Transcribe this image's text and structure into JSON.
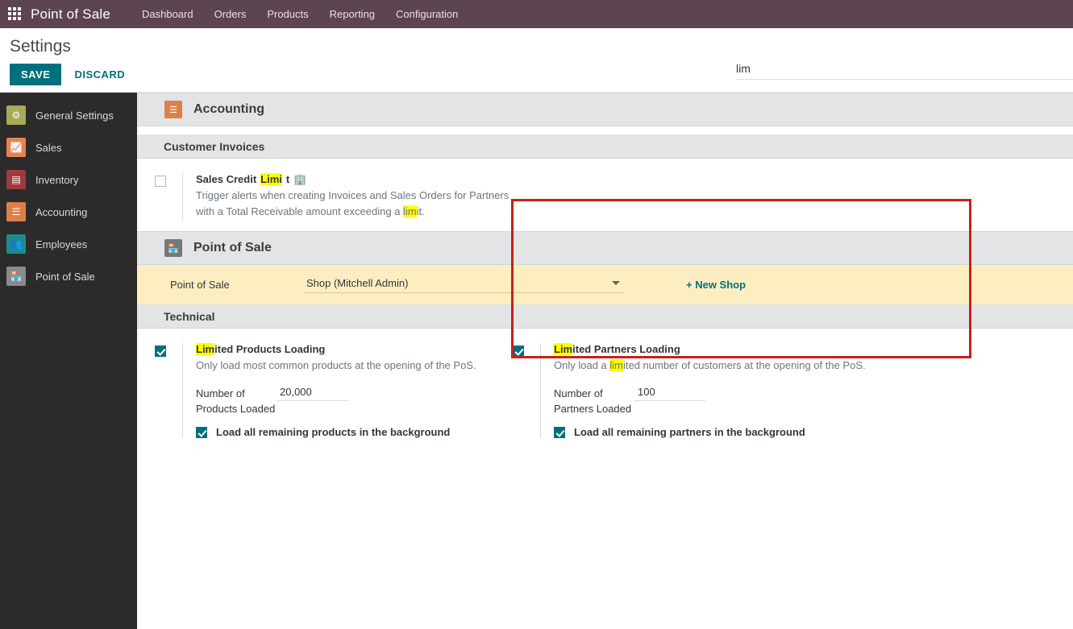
{
  "navbar": {
    "apps_icon": "apps-grid-icon",
    "brand": "Point of Sale",
    "menu": [
      {
        "label": "Dashboard"
      },
      {
        "label": "Orders"
      },
      {
        "label": "Products"
      },
      {
        "label": "Reporting"
      },
      {
        "label": "Configuration"
      }
    ]
  },
  "control_panel": {
    "title": "Settings",
    "save_label": "SAVE",
    "discard_label": "DISCARD",
    "search_value": "lim",
    "search_placeholder": ""
  },
  "sidebar": {
    "items": [
      {
        "label": "General Settings",
        "icon": "gear-icon",
        "color": "#a8a95a",
        "glyph": "⚙"
      },
      {
        "label": "Sales",
        "icon": "chart-line-icon",
        "color": "#e8834c",
        "glyph": "↗"
      },
      {
        "label": "Inventory",
        "icon": "boxes-icon",
        "color": "#9e3b3b",
        "glyph": "⬛"
      },
      {
        "label": "Accounting",
        "icon": "invoice-icon",
        "color": "#dd8048",
        "glyph": "☰"
      },
      {
        "label": "Employees",
        "icon": "people-icon",
        "color": "#1f8c8c",
        "glyph": "⛟"
      },
      {
        "label": "Point of Sale",
        "icon": "shop-icon",
        "color": "#8a8a8a",
        "glyph": "⌂"
      }
    ]
  },
  "sections": {
    "accounting": {
      "app_name": "Accounting",
      "app_icon": "accounting-app-icon",
      "app_icon_color": "#dd8048",
      "sub_header": "Customer Invoices",
      "setting": {
        "checked": false,
        "title_pre": "Sales Credit ",
        "title_hl": "Limi",
        "title_post": "t",
        "company_icon": "building-icon",
        "desc_line1": "Trigger alerts when creating Invoices and Sales Orders for Partners",
        "desc_line2_pre": "with a Total Receivable amount exceeding a ",
        "desc_line2_hl": "lim",
        "desc_line2_post": "it."
      }
    },
    "point_of_sale": {
      "app_name": "Point of Sale",
      "app_icon": "pos-app-icon",
      "app_icon_color": "#777777",
      "pos_selector": {
        "label": "Point of Sale",
        "value": "Shop (Mitchell Admin)",
        "options": [
          "Shop (Mitchell Admin)"
        ],
        "new_shop_label": "+ New Shop"
      },
      "sub_header": "Technical",
      "limited_products": {
        "checked": true,
        "title_hl": "Lim",
        "title_post": "ited Products Loading",
        "desc": "Only load most common products at the opening of the PoS.",
        "field_label": "Number of Products Loaded",
        "field_value": "20,000",
        "bg_checkbox_checked": true,
        "bg_checkbox_label": "Load all remaining products in the background"
      },
      "limited_partners": {
        "checked": true,
        "title_hl": "Lim",
        "title_post": "ited Partners Loading",
        "desc_pre": "Only load a ",
        "desc_hl": "lim",
        "desc_post": "ited number of customers at the opening of the PoS.",
        "field_label": "Number of Partners Loaded",
        "field_value": "100",
        "bg_checkbox_checked": true,
        "bg_checkbox_label": "Load all remaining partners in the background"
      }
    }
  },
  "colors": {
    "navbar_bg": "#5c4450",
    "accent_teal": "#00707f",
    "highlight_yellow": "#ffff00",
    "highlight_box_red": "#c82015",
    "pos_band_bg": "#fdeec1"
  }
}
